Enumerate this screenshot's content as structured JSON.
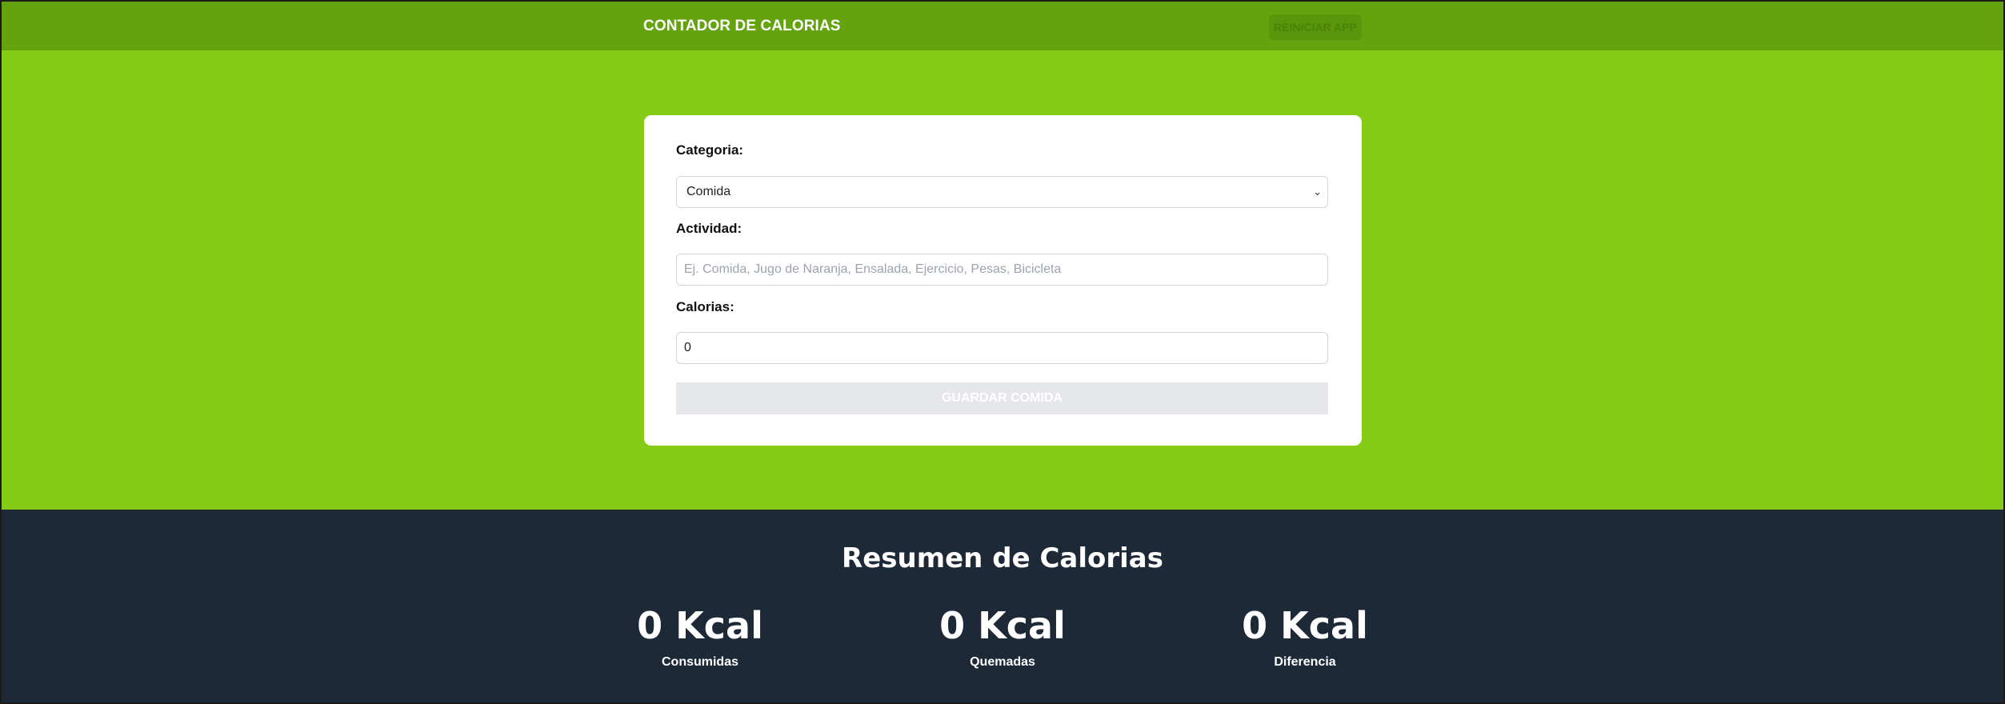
{
  "header": {
    "title": "CONTADOR DE CALORIAS",
    "reset_label": "REINICIAR APP"
  },
  "form": {
    "category_label": "Categoria:",
    "category_value": "Comida",
    "activity_label": "Actividad:",
    "activity_placeholder": "Ej. Comida, Jugo de Naranja, Ensalada, Ejercicio, Pesas, Bicicleta",
    "calories_label": "Calorias:",
    "calories_value": "0",
    "submit_label": "GUARDAR COMIDA"
  },
  "summary": {
    "title": "Resumen de Calorias",
    "stats": [
      {
        "value": "0 Kcal",
        "label": "Consumidas"
      },
      {
        "value": "0 Kcal",
        "label": "Quemadas"
      },
      {
        "value": "0 Kcal",
        "label": "Diferencia"
      }
    ]
  },
  "colors": {
    "header_bg": "#64a30d",
    "hero_bg": "#84cc16",
    "summary_bg": "#1e2937",
    "card_bg": "#ffffff",
    "disabled_button_bg": "#e5e7eb"
  }
}
